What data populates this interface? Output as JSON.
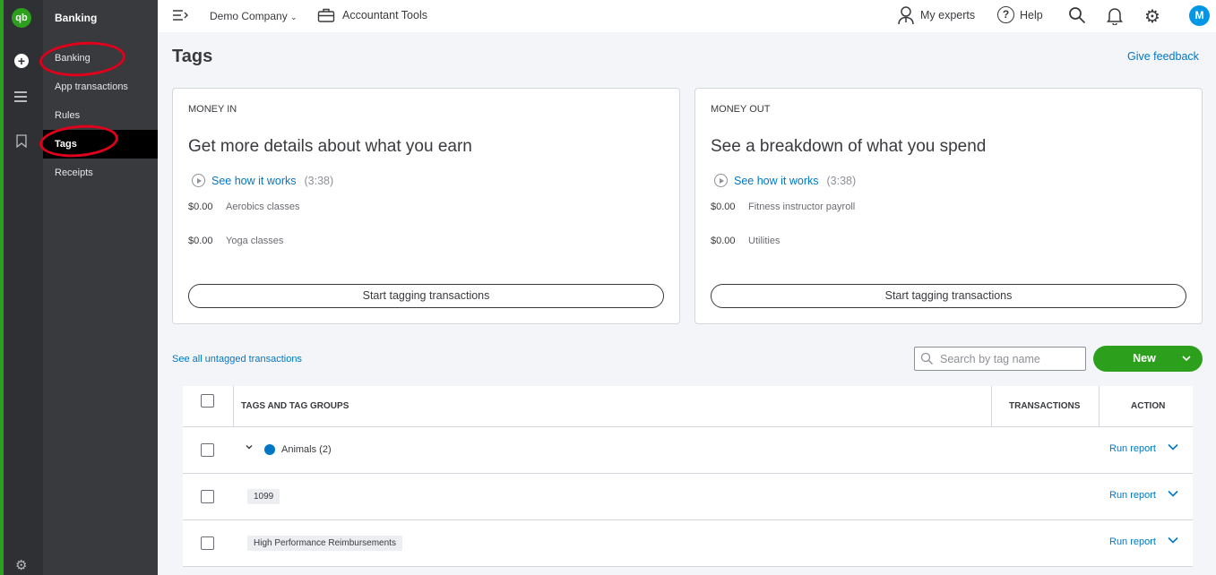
{
  "rail": {
    "logo": "qb",
    "plus": "+"
  },
  "subnav": {
    "title": "Banking",
    "items": [
      {
        "label": "Banking"
      },
      {
        "label": "App transactions"
      },
      {
        "label": "Rules"
      },
      {
        "label": "Tags"
      },
      {
        "label": "Receipts"
      }
    ]
  },
  "topbar": {
    "company": "Demo Company",
    "accountant_tools": "Accountant Tools",
    "my_experts": "My experts",
    "help_icon": "?",
    "help": "Help",
    "avatar": "M"
  },
  "page": {
    "title": "Tags",
    "feedback": "Give feedback"
  },
  "cards": [
    {
      "label": "MONEY IN",
      "heading": "Get more details about what you earn",
      "video_link": "See how it works",
      "duration": "(3:38)",
      "rows": [
        {
          "amount": "$0.00",
          "name": "Aerobics classes"
        },
        {
          "amount": "$0.00",
          "name": "Yoga classes"
        }
      ],
      "button": "Start tagging transactions"
    },
    {
      "label": "MONEY OUT",
      "heading": "See a breakdown of what you spend",
      "video_link": "See how it works",
      "duration": "(3:38)",
      "rows": [
        {
          "amount": "$0.00",
          "name": "Fitness instructor payroll"
        },
        {
          "amount": "$0.00",
          "name": "Utilities"
        }
      ],
      "button": "Start tagging transactions"
    }
  ],
  "toolbar": {
    "untagged_link": "See all untagged transactions",
    "search_placeholder": "Search by tag name",
    "new_button": "New"
  },
  "table": {
    "columns": [
      "TAGS AND TAG GROUPS",
      "TRANSACTIONS",
      "ACTION"
    ],
    "rows": [
      {
        "name": "Animals (2)",
        "type": "group",
        "action": "Run report"
      },
      {
        "name": "1099",
        "type": "tag",
        "action": "Run report"
      },
      {
        "name": "High Performance Reimbursements",
        "type": "tag",
        "action": "Run report"
      }
    ]
  },
  "colors": {
    "brand_green": "#2ca01c",
    "link_blue": "#0077c5",
    "annotation_red": "#e0001b"
  }
}
